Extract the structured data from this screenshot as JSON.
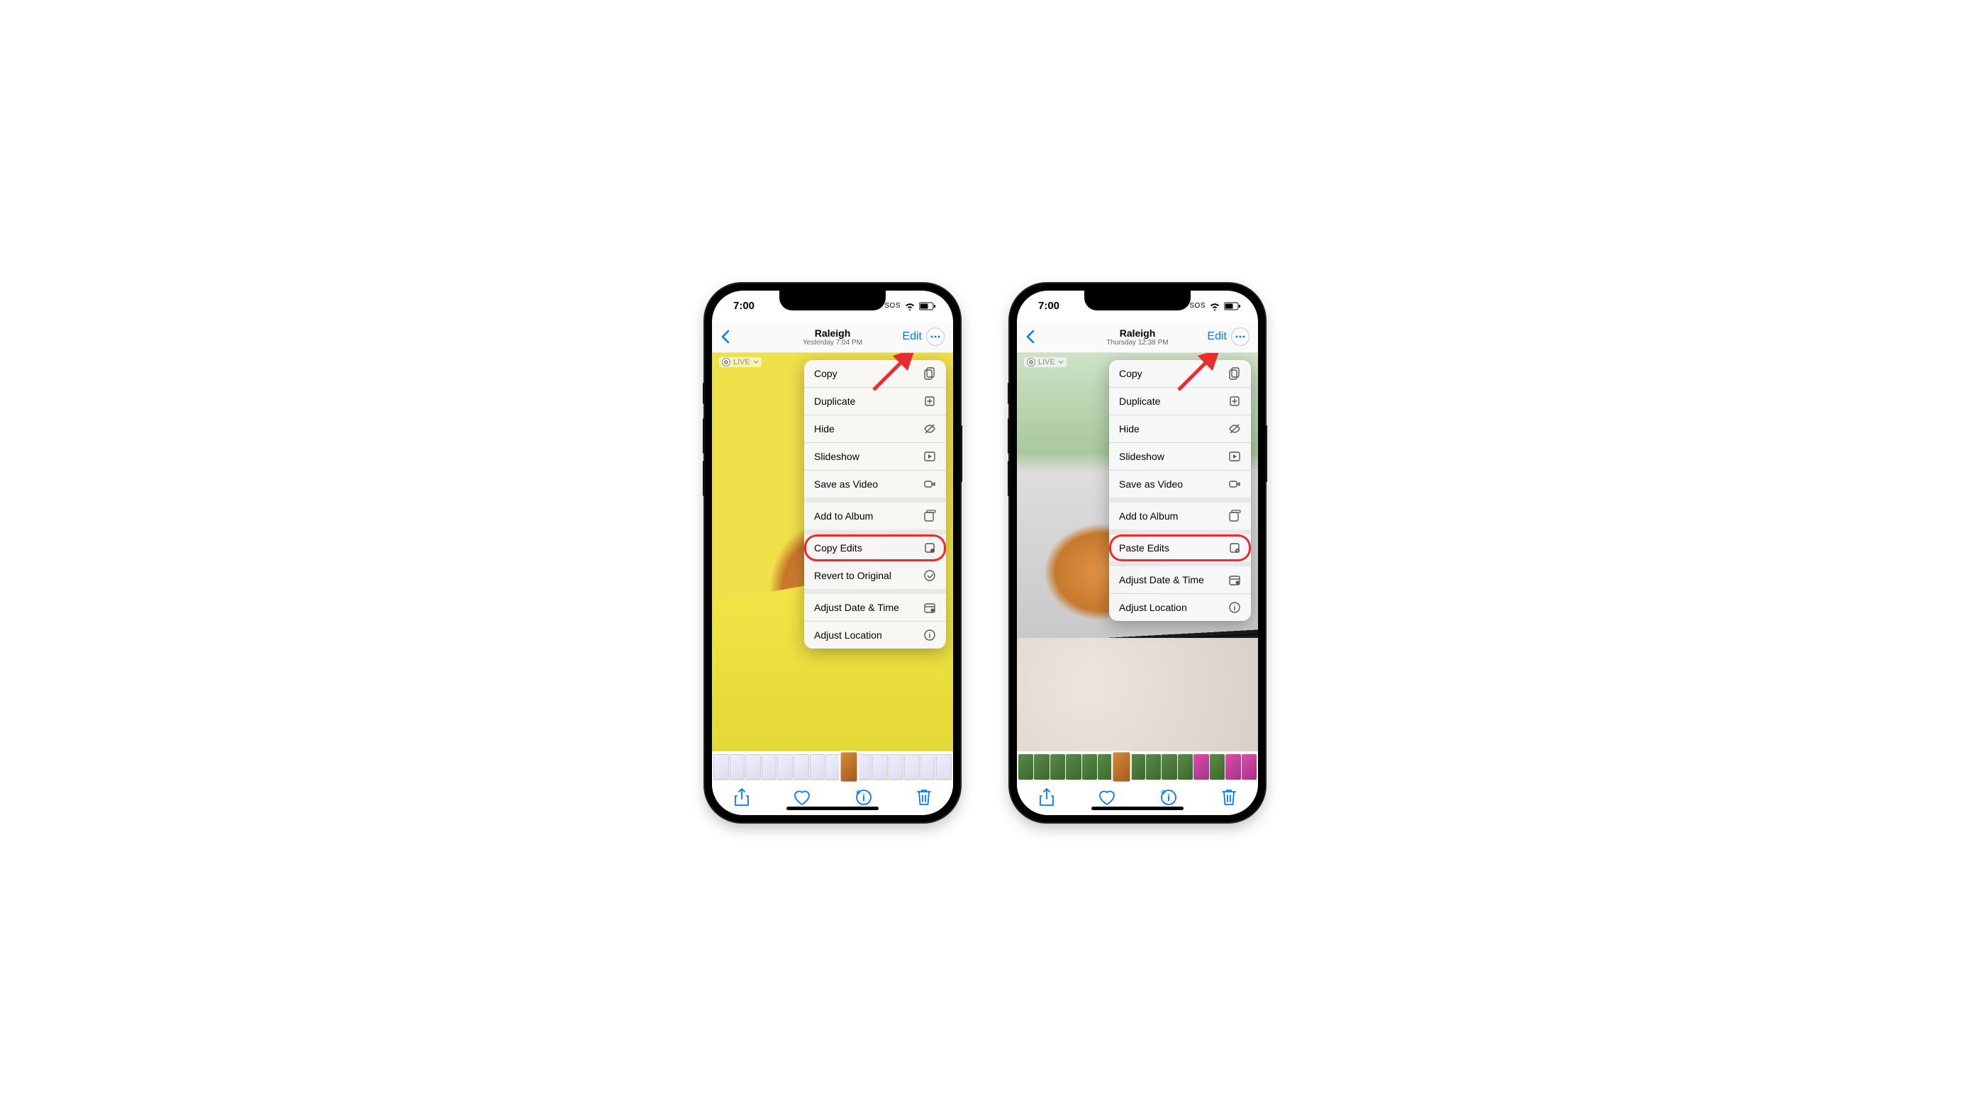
{
  "phones": [
    {
      "status": {
        "time": "7:00",
        "sos": "SOS"
      },
      "nav": {
        "location": "Raleigh",
        "timestamp": "Yesterday 7:04 PM",
        "edit": "Edit"
      },
      "live_label": "LIVE",
      "menu": [
        {
          "group": 0,
          "label": "Copy",
          "icon": "copy"
        },
        {
          "group": 0,
          "label": "Duplicate",
          "icon": "duplicate"
        },
        {
          "group": 0,
          "label": "Hide",
          "icon": "hide"
        },
        {
          "group": 0,
          "label": "Slideshow",
          "icon": "slideshow"
        },
        {
          "group": 0,
          "label": "Save as Video",
          "icon": "video"
        },
        {
          "group": 1,
          "label": "Add to Album",
          "icon": "album"
        },
        {
          "group": 2,
          "label": "Copy Edits",
          "icon": "copy-edits",
          "highlight": true
        },
        {
          "group": 2,
          "label": "Revert to Original",
          "icon": "revert"
        },
        {
          "group": 3,
          "label": "Adjust Date & Time",
          "icon": "calendar"
        },
        {
          "group": 3,
          "label": "Adjust Location",
          "icon": "location"
        }
      ],
      "thumbs": [
        "ui",
        "ui",
        "ui",
        "ui",
        "ui",
        "ui",
        "ui",
        "ui",
        "cat current",
        "ui",
        "ui",
        "ui",
        "ui",
        "ui",
        "ui"
      ]
    },
    {
      "status": {
        "time": "7:00",
        "sos": "SOS"
      },
      "nav": {
        "location": "Raleigh",
        "timestamp": "Thursday 12:38 PM",
        "edit": "Edit"
      },
      "live_label": "LIVE",
      "menu": [
        {
          "group": 0,
          "label": "Copy",
          "icon": "copy"
        },
        {
          "group": 0,
          "label": "Duplicate",
          "icon": "duplicate"
        },
        {
          "group": 0,
          "label": "Hide",
          "icon": "hide"
        },
        {
          "group": 0,
          "label": "Slideshow",
          "icon": "slideshow"
        },
        {
          "group": 0,
          "label": "Save as Video",
          "icon": "video"
        },
        {
          "group": 1,
          "label": "Add to Album",
          "icon": "album"
        },
        {
          "group": 2,
          "label": "Paste Edits",
          "icon": "paste-edits",
          "highlight": true
        },
        {
          "group": 3,
          "label": "Adjust Date & Time",
          "icon": "calendar"
        },
        {
          "group": 3,
          "label": "Adjust Location",
          "icon": "location"
        }
      ],
      "thumbs": [
        "nature",
        "nature",
        "nature",
        "nature",
        "nature",
        "nature",
        "cat current",
        "nature",
        "nature",
        "nature",
        "nature",
        "flower",
        "nature",
        "flower",
        "flower"
      ]
    }
  ]
}
